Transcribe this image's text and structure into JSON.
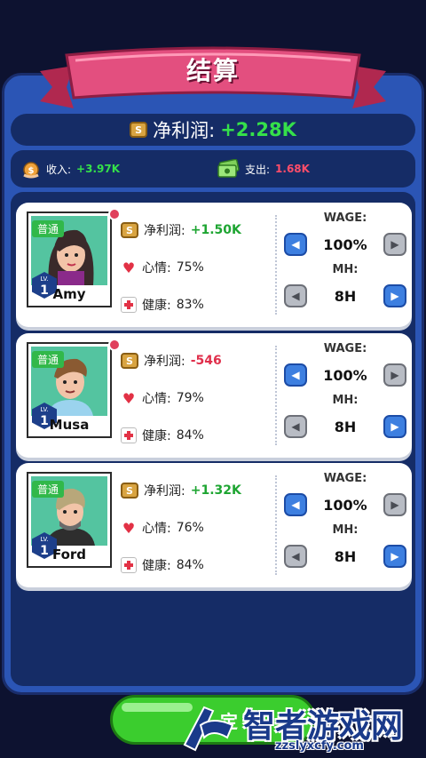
{
  "header": {
    "title": "结算"
  },
  "summary": {
    "net_label": "净利润:",
    "net_value": "+2.28K",
    "income_label": "收入:",
    "income_value": "+3.97K",
    "expense_label": "支出:",
    "expense_value": "1.68K",
    "coin_symbol": "S"
  },
  "employees": [
    {
      "name": "Amy",
      "tier": "普通",
      "level": "1",
      "level_prefix": "LV.",
      "profit_label": "净利润:",
      "profit": "+1.50K",
      "mood_label": "心情:",
      "mood": "75%",
      "health_label": "健康:",
      "health": "83%",
      "wage_label": "WAGE:",
      "wage": "100%",
      "mh_label": "MH:",
      "mh": "8H"
    },
    {
      "name": "Musa",
      "tier": "普通",
      "level": "1",
      "level_prefix": "LV.",
      "profit_label": "净利润:",
      "profit": "-546",
      "mood_label": "心情:",
      "mood": "79%",
      "health_label": "健康:",
      "health": "84%",
      "wage_label": "WAGE:",
      "wage": "100%",
      "mh_label": "MH:",
      "mh": "8H"
    },
    {
      "name": "Ford",
      "tier": "普通",
      "level": "1",
      "level_prefix": "LV.",
      "profit_label": "净利润:",
      "profit": "+1.32K",
      "mood_label": "心情:",
      "mood": "76%",
      "health_label": "健康:",
      "health": "84%",
      "wage_label": "WAGE:",
      "wage": "100%",
      "mh_label": "MH:",
      "mh": "8H"
    }
  ],
  "footer": {
    "confirm_label": "定"
  },
  "watermark": {
    "text": "智者游戏网",
    "url": "zzslyxcfy.com"
  },
  "colors": {
    "positive": "#35e04a",
    "negative": "#ff4d6a",
    "panel": "#2b55b5",
    "ribbon": "#e34f7f"
  },
  "icons": [
    "coin-icon",
    "money-bag-icon",
    "cash-stack-icon",
    "heart-icon",
    "medical-cross-icon",
    "arrow-left-icon",
    "arrow-right-icon"
  ]
}
